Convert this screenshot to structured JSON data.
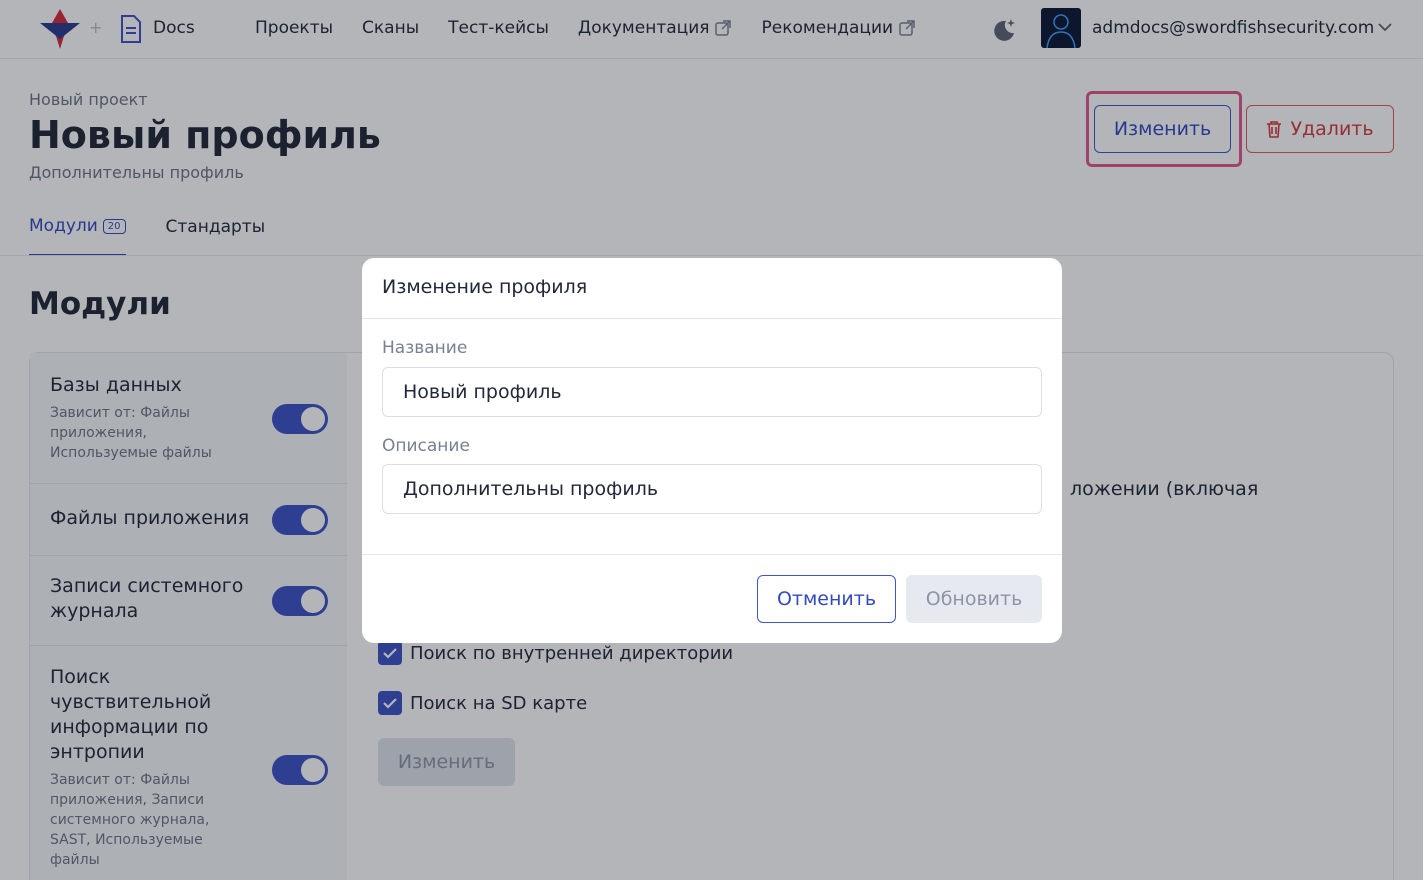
{
  "header": {
    "brand": "Docs",
    "nav": [
      {
        "label": "Проекты"
      },
      {
        "label": "Сканы"
      },
      {
        "label": "Тест-кейсы"
      },
      {
        "label": "Документация"
      },
      {
        "label": "Рекомендации"
      }
    ],
    "user_email": "admdocs@swordfishsecurity.com"
  },
  "page": {
    "breadcrumb": "Новый проект",
    "title": "Новый профиль",
    "subtitle": "Дополнительны профиль",
    "edit_label": "Изменить",
    "delete_label": "Удалить",
    "tabs": [
      {
        "label": "Модули",
        "badge": "20"
      },
      {
        "label": "Стандарты"
      }
    ]
  },
  "content": {
    "section_title": "Модули",
    "modules": [
      {
        "name": "Базы данных",
        "depends": "Зависит от: Файлы приложения, Используемые файлы"
      },
      {
        "name": "Файлы приложения",
        "depends": ""
      },
      {
        "name": "Записи системного журнала",
        "depends": ""
      },
      {
        "name": "Поиск чувствительной информации по энтропии",
        "depends": "Зависит от: Файлы приложения, Записи системного журнала, SAST, Используемые файлы"
      }
    ],
    "bg_partial_text": "ложении (включая",
    "checks": [
      {
        "label": "Поиск по внутренней директории"
      },
      {
        "label": "Поиск на SD карте"
      }
    ],
    "bg_edit_label": "Изменить"
  },
  "modal": {
    "title": "Изменение профиля",
    "name_label": "Название",
    "name_value": "Новый профиль",
    "desc_label": "Описание",
    "desc_value": "Дополнительны профиль",
    "cancel_label": "Отменить",
    "update_label": "Обновить"
  },
  "colors": {
    "accent": "#3249c0",
    "danger": "#d43a3a",
    "highlight": "#e2568c"
  }
}
